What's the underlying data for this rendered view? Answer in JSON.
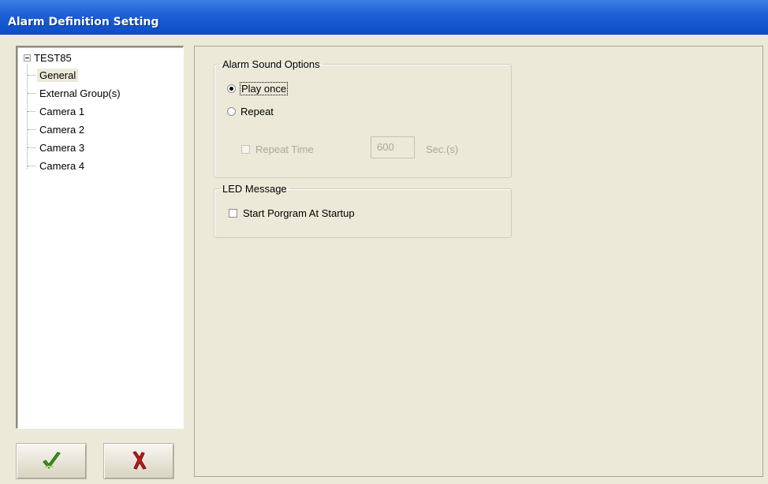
{
  "window": {
    "title": "Alarm Definition Setting"
  },
  "tree": {
    "root": "TEST85",
    "items": [
      {
        "label": "General",
        "selected": true
      },
      {
        "label": "External Group(s)",
        "selected": false
      },
      {
        "label": "Camera 1",
        "selected": false
      },
      {
        "label": "Camera 2",
        "selected": false
      },
      {
        "label": "Camera 3",
        "selected": false
      },
      {
        "label": "Camera 4",
        "selected": false
      }
    ]
  },
  "buttons": {
    "ok_icon": "green-checkmark-icon",
    "cancel_icon": "red-x-icon"
  },
  "alarm_sound": {
    "legend": "Alarm Sound Options",
    "play_once_label": "Play once",
    "repeat_label": "Repeat",
    "selected": "Play once",
    "repeat_time_label": "Repeat Time",
    "repeat_time_value": "600",
    "repeat_time_unit": "Sec.(s)",
    "repeat_time_enabled": false
  },
  "led_message": {
    "legend": "LED Message",
    "start_program_label": "Start Porgram At Startup",
    "start_program_checked": false
  },
  "colors": {
    "titlebar": "#1c5fd6",
    "window_bg": "#ece9d8",
    "ok_icon": "#3a9a1a",
    "cancel_icon": "#c41a1a"
  }
}
